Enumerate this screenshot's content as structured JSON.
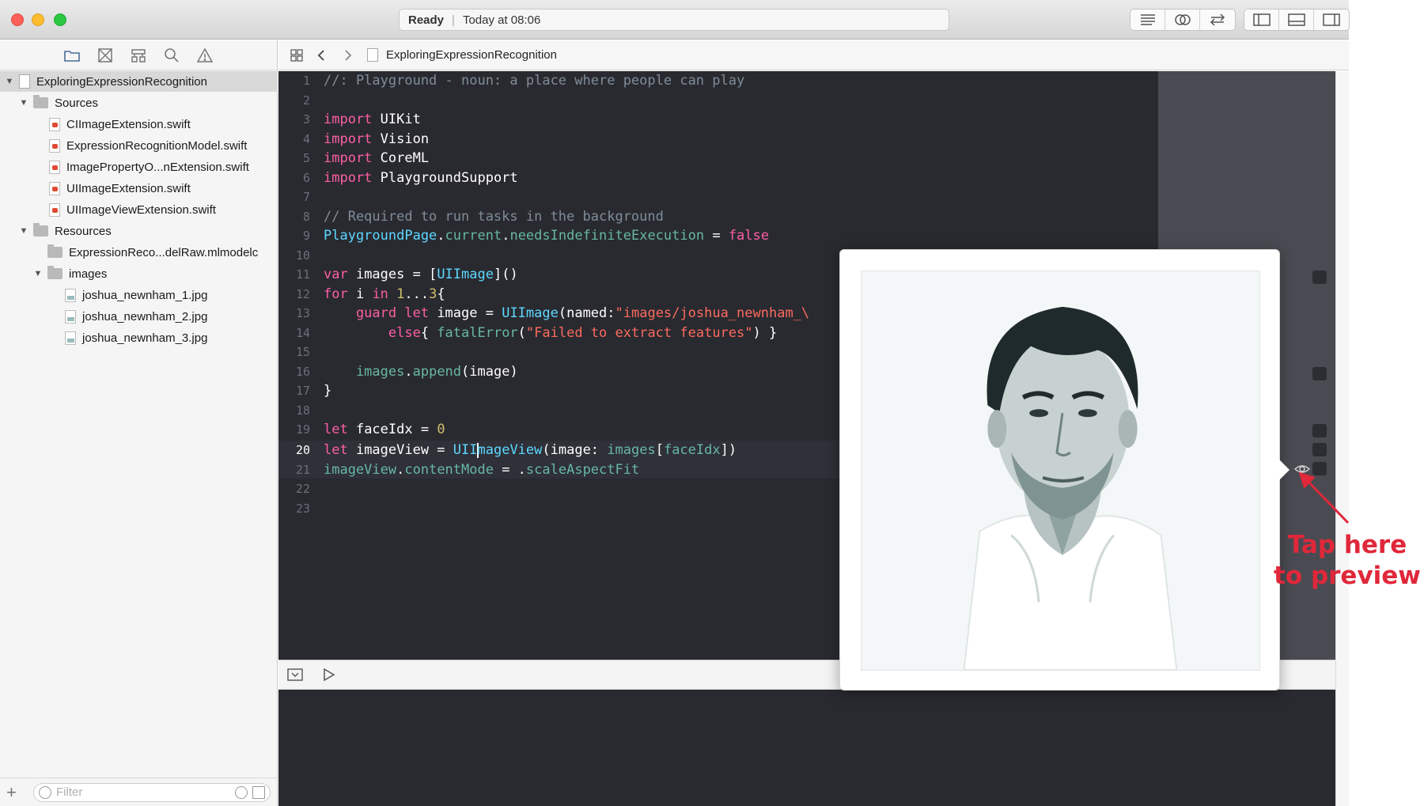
{
  "window": {
    "status": "Ready",
    "timestamp": "Today at 08:06"
  },
  "toolbar": {
    "editor_buttons": [
      "standard-editor-icon",
      "assistant-editor-icon",
      "version-editor-icon"
    ],
    "view_buttons": [
      "navigator-toggle-icon",
      "debug-area-toggle-icon",
      "utilities-toggle-icon"
    ]
  },
  "navigator": {
    "toolbar_icons": [
      "folder-icon",
      "source-control-icon",
      "symbol-icon",
      "find-icon",
      "warning-icon"
    ],
    "project": "ExploringExpressionRecognition",
    "sources_label": "Sources",
    "sources": [
      "CIImageExtension.swift",
      "ExpressionRecognitionModel.swift",
      "ImagePropertyO...nExtension.swift",
      "UIImageExtension.swift",
      "UIImageViewExtension.swift"
    ],
    "resources_label": "Resources",
    "model_file": "ExpressionReco...delRaw.mlmodelc",
    "images_label": "images",
    "images": [
      "joshua_newnham_1.jpg",
      "joshua_newnham_2.jpg",
      "joshua_newnham_3.jpg"
    ],
    "filter_placeholder": "Filter",
    "add_label": "+"
  },
  "jumpbar": {
    "file_name": "ExploringExpressionRecognition"
  },
  "code": {
    "current_line": 20,
    "line_numbers": [
      "1",
      "2",
      "3",
      "4",
      "5",
      "6",
      "7",
      "8",
      "9",
      "10",
      "11",
      "12",
      "13",
      "14",
      "15",
      "16",
      "17",
      "18",
      "19",
      "20",
      "21",
      "22",
      "23"
    ],
    "line1": "//: Playground - noun: a place where people can play",
    "import_kw": "import",
    "module_uikit": " UIKit",
    "module_vision": " Vision",
    "module_coreml": " CoreML",
    "module_playground": " PlaygroundSupport",
    "line8": "// Required to run tasks in the background",
    "l9_playgroundpage": "PlaygroundPage",
    "l9_dot1": ".",
    "l9_current": "current",
    "l9_dot2": ".",
    "l9_needs": "needsIndefiniteExecution",
    "l9_eq": " = ",
    "l9_false": "false",
    "l11_var": "var",
    "l11_images": " images = [",
    "l11_type": "UIImage",
    "l11_end": "]()",
    "l12_for": "for",
    "l12_i": " i ",
    "l12_in": "in",
    "l12_space": " ",
    "l12_one": "1",
    "l12_range": "...",
    "l12_three": "3",
    "l12_brace": "{",
    "l13_guard": "    guard",
    "l13_let": " let",
    "l13_image": " image = ",
    "l13_type": "UIImage",
    "l13_named": "(named:",
    "l13_str": "\"images/joshua_newnham_\\",
    "l14_else": "        else",
    "l14_brace": "{ ",
    "l14_fatal": "fatalError",
    "l14_paren": "(",
    "l14_str": "\"Failed to extract features\"",
    "l14_end": ") }",
    "l16_images": "    images",
    "l16_dot": ".",
    "l16_append": "append",
    "l16_end": "(image)",
    "l17": "}",
    "l19_let": "let",
    "l19_face": " faceIdx = ",
    "l19_zero": "0",
    "l20_let": "let",
    "l20_iv": " imageView = ",
    "l20_type_a": "UII",
    "l20_type_b": "mageView",
    "l20_args": "(image: ",
    "l20_images": "images",
    "l20_bracket": "[",
    "l20_faceidx": "faceIdx",
    "l20_end": "])",
    "l21_iv": "imageView",
    "l21_dot": ".",
    "l21_mode": "contentMode",
    "l21_eq": " = .",
    "l21_fit": "scaleAspectFit"
  },
  "preview": {
    "subject": "portrait-photo"
  },
  "annotation": {
    "line1": "Tap here",
    "line2": "to preview",
    "color": "#e0283a"
  },
  "colors": {
    "editor_bg": "#292a30",
    "keyword": "#fc5fa3",
    "string": "#fc6a5d",
    "comment": "#7f8c98",
    "number": "#d0bf69",
    "type": "#5dd8ff"
  }
}
